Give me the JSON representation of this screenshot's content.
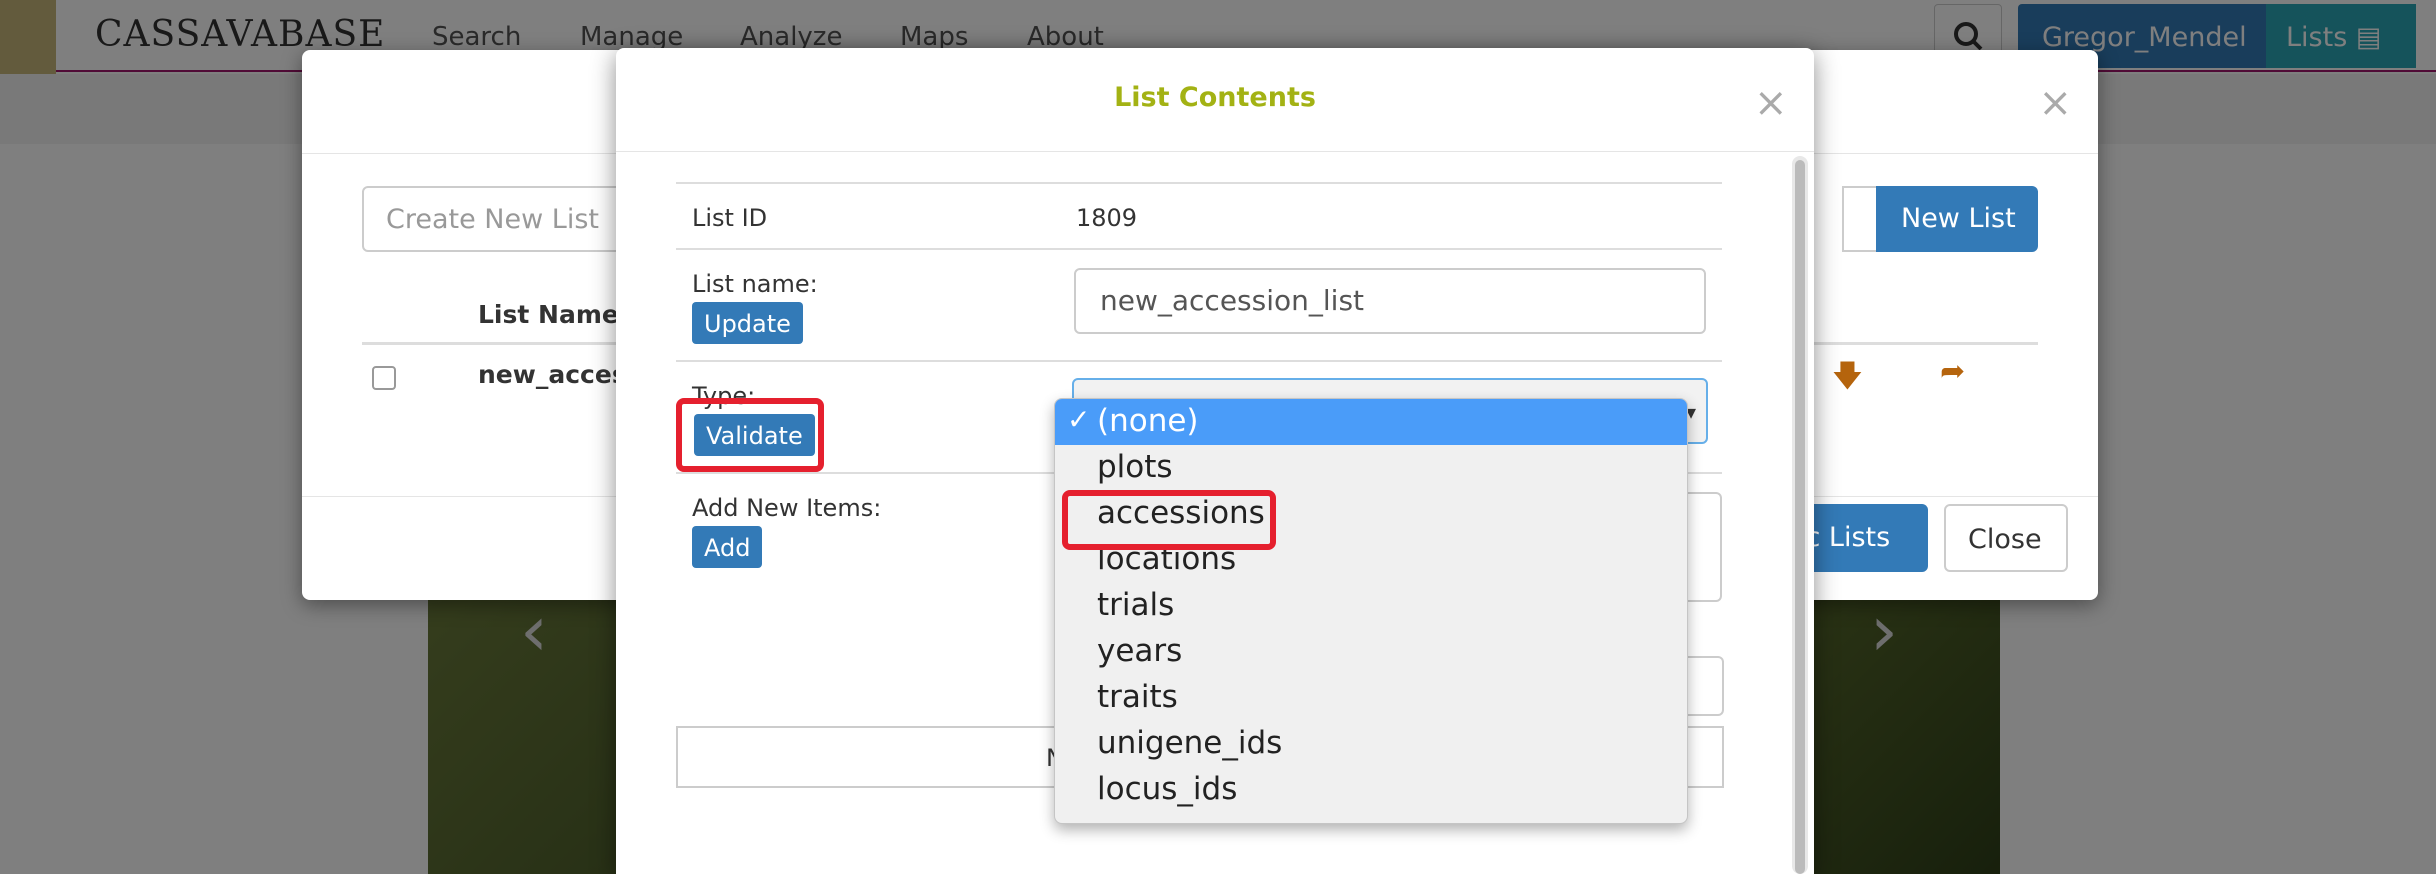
{
  "nav": {
    "brand": "CASSAVABASE",
    "items": [
      "Search",
      "Manage",
      "Analyze",
      "Maps",
      "About"
    ],
    "user": "Gregor_Mendel",
    "lists_label": "Lists"
  },
  "lists_modal": {
    "close_symbol": "×",
    "create_placeholder": "Create New List",
    "new_list_button": "New List",
    "column_list_name": "List Name",
    "row_name_partial": "new_acces",
    "public_lists_button_partial": "ic Lists",
    "close_button": "Close"
  },
  "list_contents": {
    "title": "List Contents",
    "close_symbol": "×",
    "list_id_label": "List ID",
    "list_id_value": "1809",
    "list_name_label": "List name:",
    "list_name_value": "new_accession_list",
    "update_button": "Update",
    "type_label": "Type:",
    "validate_button": "Validate",
    "add_items_label": "Add New Items:",
    "add_button": "Add",
    "tab_partial": "N"
  },
  "type_dropdown": {
    "selected": "(none)",
    "options": [
      "(none)",
      "plots",
      "accessions",
      "locations",
      "trials",
      "years",
      "traits",
      "unigene_ids",
      "locus_ids"
    ],
    "highlighted_option": "accessions"
  },
  "colors": {
    "primary": "#337ab7",
    "title": "#a3b214",
    "highlight": "#e5202e",
    "dropdown_selected": "#4a9cf9",
    "action_icons": "#b5640d"
  }
}
